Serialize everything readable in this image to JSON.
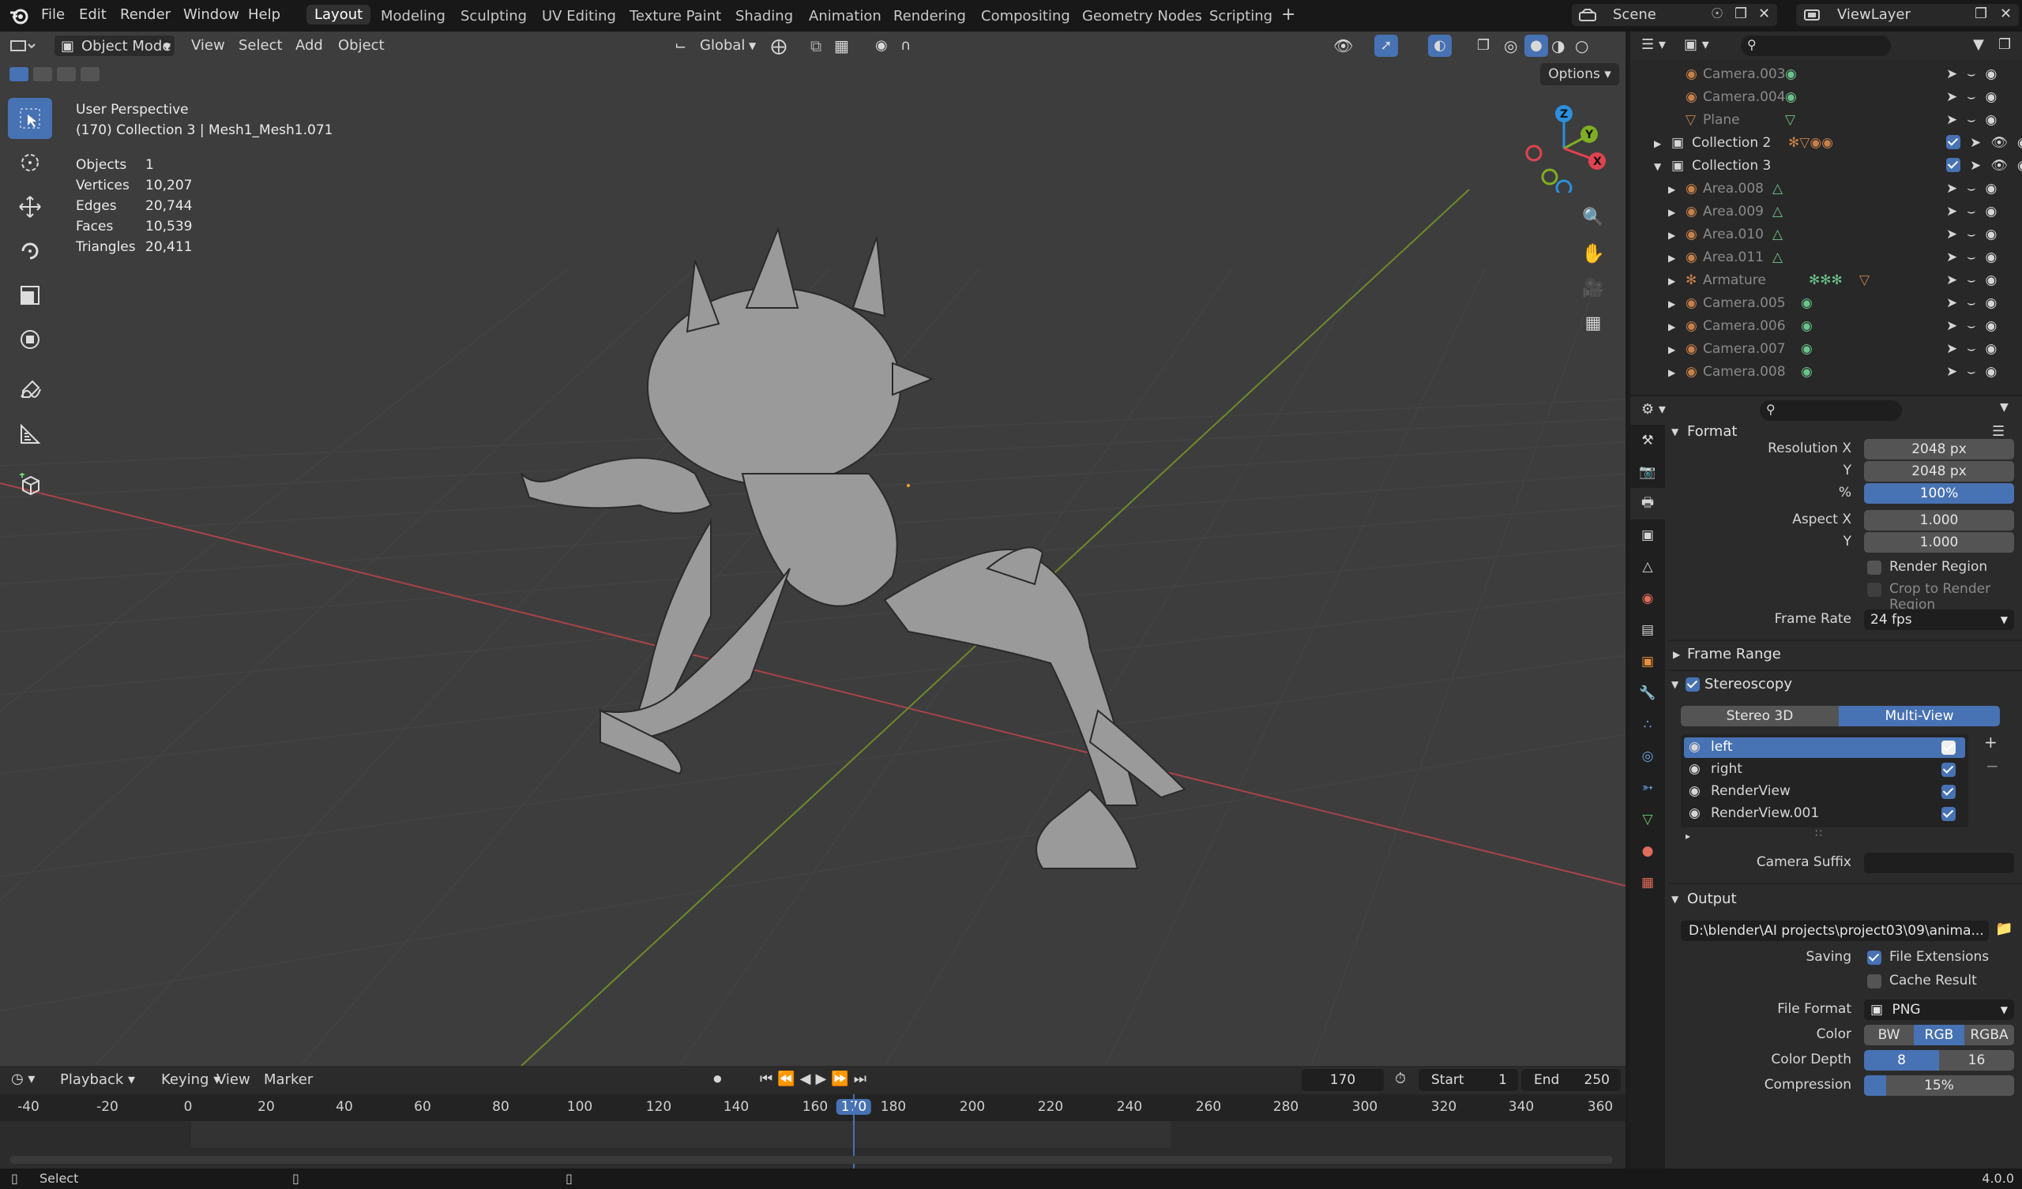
{
  "topbar": {
    "menus": [
      "File",
      "Edit",
      "Render",
      "Window",
      "Help"
    ],
    "workspaces": [
      "Layout",
      "Modeling",
      "Sculpting",
      "UV Editing",
      "Texture Paint",
      "Shading",
      "Animation",
      "Rendering",
      "Compositing",
      "Geometry Nodes",
      "Scripting"
    ],
    "active_workspace": "Layout",
    "scene": "Scene",
    "view_layer": "ViewLayer"
  },
  "viewport": {
    "mode": "Object Mode",
    "menus": [
      "View",
      "Select",
      "Add",
      "Object"
    ],
    "orientation": "Global",
    "options_label": "Options",
    "view_name": "User Perspective",
    "context": "(170) Collection 3 | Mesh1_Mesh1.071",
    "stats": [
      {
        "label": "Objects",
        "value": "1"
      },
      {
        "label": "Vertices",
        "value": "10,207"
      },
      {
        "label": "Edges",
        "value": "20,744"
      },
      {
        "label": "Faces",
        "value": "10,539"
      },
      {
        "label": "Triangles",
        "value": "20,411"
      }
    ],
    "gizmo_axes": [
      "Z",
      "Y",
      "X"
    ]
  },
  "timeline": {
    "menus": [
      "Playback",
      "Keying",
      "View",
      "Marker"
    ],
    "current_frame": "170",
    "start_label": "Start",
    "start": "1",
    "end_label": "End",
    "end": "250",
    "ruler": [
      "-40",
      "-20",
      "0",
      "20",
      "40",
      "60",
      "80",
      "100",
      "120",
      "140",
      "160",
      "170",
      "180",
      "200",
      "220",
      "240",
      "260",
      "280",
      "300",
      "320",
      "340",
      "360"
    ]
  },
  "statusbar": {
    "left": "Select",
    "version": "4.0.0"
  },
  "outliner": {
    "rows": [
      {
        "name": "Camera.003",
        "type": "camera",
        "indent": 2
      },
      {
        "name": "Camera.004",
        "type": "camera",
        "indent": 2
      },
      {
        "name": "Plane",
        "type": "mesh",
        "indent": 2
      },
      {
        "name": "Collection 2",
        "type": "collection",
        "indent": 1
      },
      {
        "name": "Collection 3",
        "type": "collection",
        "indent": 1
      },
      {
        "name": "Area.008",
        "type": "light",
        "indent": 2
      },
      {
        "name": "Area.009",
        "type": "light",
        "indent": 2
      },
      {
        "name": "Area.010",
        "type": "light",
        "indent": 2
      },
      {
        "name": "Area.011",
        "type": "light",
        "indent": 2
      },
      {
        "name": "Armature",
        "type": "armature",
        "indent": 2
      },
      {
        "name": "Camera.005",
        "type": "camera",
        "indent": 2
      },
      {
        "name": "Camera.006",
        "type": "camera",
        "indent": 2
      },
      {
        "name": "Camera.007",
        "type": "camera",
        "indent": 2
      },
      {
        "name": "Camera.008",
        "type": "camera",
        "indent": 2
      }
    ]
  },
  "properties": {
    "format": {
      "title": "Format",
      "resolution_x_label": "Resolution X",
      "resolution_x": "2048 px",
      "resolution_y_label": "Y",
      "resolution_y": "2048 px",
      "percent_label": "%",
      "percent": "100%",
      "aspect_x_label": "Aspect X",
      "aspect_x": "1.000",
      "aspect_y_label": "Y",
      "aspect_y": "1.000",
      "render_region": "Render Region",
      "crop_region": "Crop to Render Region",
      "frame_rate_label": "Frame Rate",
      "frame_rate": "24 fps"
    },
    "frame_range": {
      "title": "Frame Range"
    },
    "stereoscopy": {
      "title": "Stereoscopy",
      "modes": [
        "Stereo 3D",
        "Multi-View"
      ],
      "active_mode": "Multi-View",
      "views": [
        "left",
        "right",
        "RenderView",
        "RenderView.001"
      ],
      "camera_suffix_label": "Camera Suffix",
      "camera_suffix": ""
    },
    "output": {
      "title": "Output",
      "path": "D:\\blender\\AI projects\\project03\\09\\anima...",
      "saving_label": "Saving",
      "file_extensions": "File Extensions",
      "cache_result": "Cache Result",
      "file_format_label": "File Format",
      "file_format": "PNG",
      "color_label": "Color",
      "color_modes": [
        "BW",
        "RGB",
        "RGBA"
      ],
      "active_color": "RGB",
      "color_depth_label": "Color Depth",
      "depths": [
        "8",
        "16"
      ],
      "active_depth": "8",
      "compression_label": "Compression",
      "compression": "15%"
    }
  },
  "colors": {
    "accent": "#4772b3",
    "x_axis": "#e0434f",
    "y_axis": "#7fad23",
    "z_axis": "#2c8fdf",
    "object_orange": "#c8804a"
  }
}
